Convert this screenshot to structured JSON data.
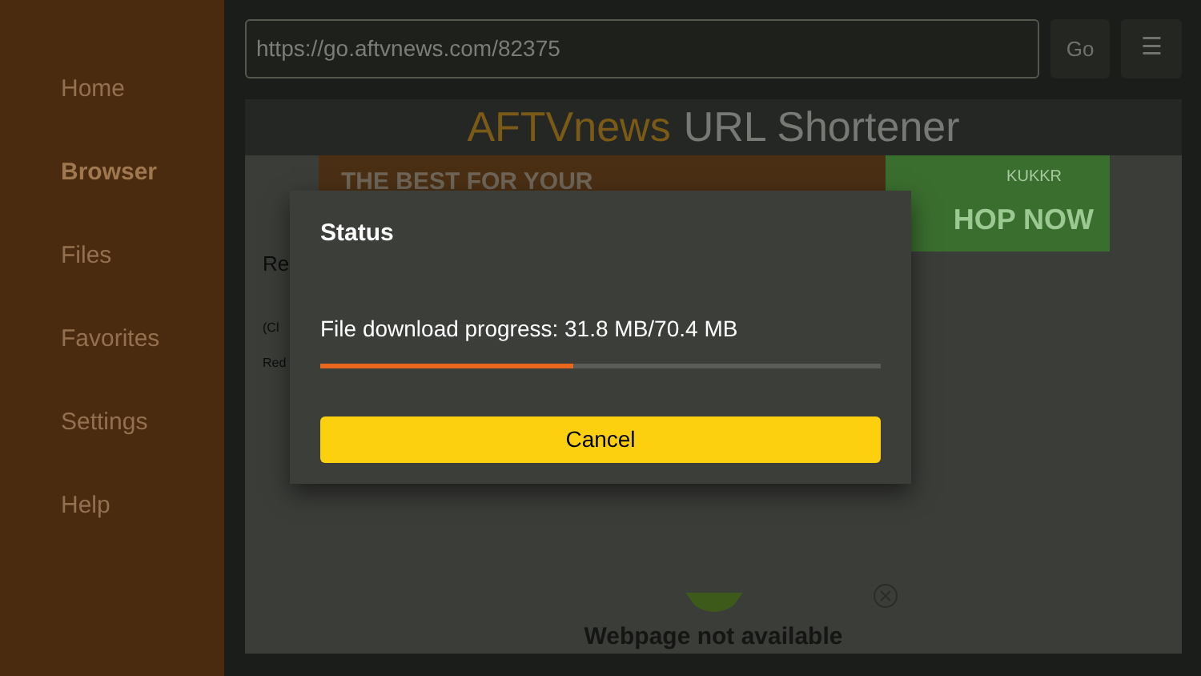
{
  "sidebar": {
    "items": [
      {
        "label": "Home",
        "selected": false
      },
      {
        "label": "Browser",
        "selected": true
      },
      {
        "label": "Files",
        "selected": false
      },
      {
        "label": "Favorites",
        "selected": false
      },
      {
        "label": "Settings",
        "selected": false
      },
      {
        "label": "Help",
        "selected": false
      }
    ]
  },
  "toolbar": {
    "url": "https://go.aftvnews.com/82375",
    "go": "Go",
    "menu": "☰"
  },
  "page": {
    "logo_icon_text": "AFTV",
    "logo_accent": "news",
    "title": "URL Shortener",
    "ad": {
      "headline": "THE BEST FOR YOUR",
      "brand": "KUKKR",
      "cta": "HOP NOW"
    },
    "side_texts": [
      "Re",
      "(Cl",
      "Red"
    ],
    "error": "Webpage not available"
  },
  "dialog": {
    "title": "Status",
    "message": "File download progress: 31.8 MB/70.4 MB",
    "level": 0.45,
    "button": "Cancel"
  }
}
